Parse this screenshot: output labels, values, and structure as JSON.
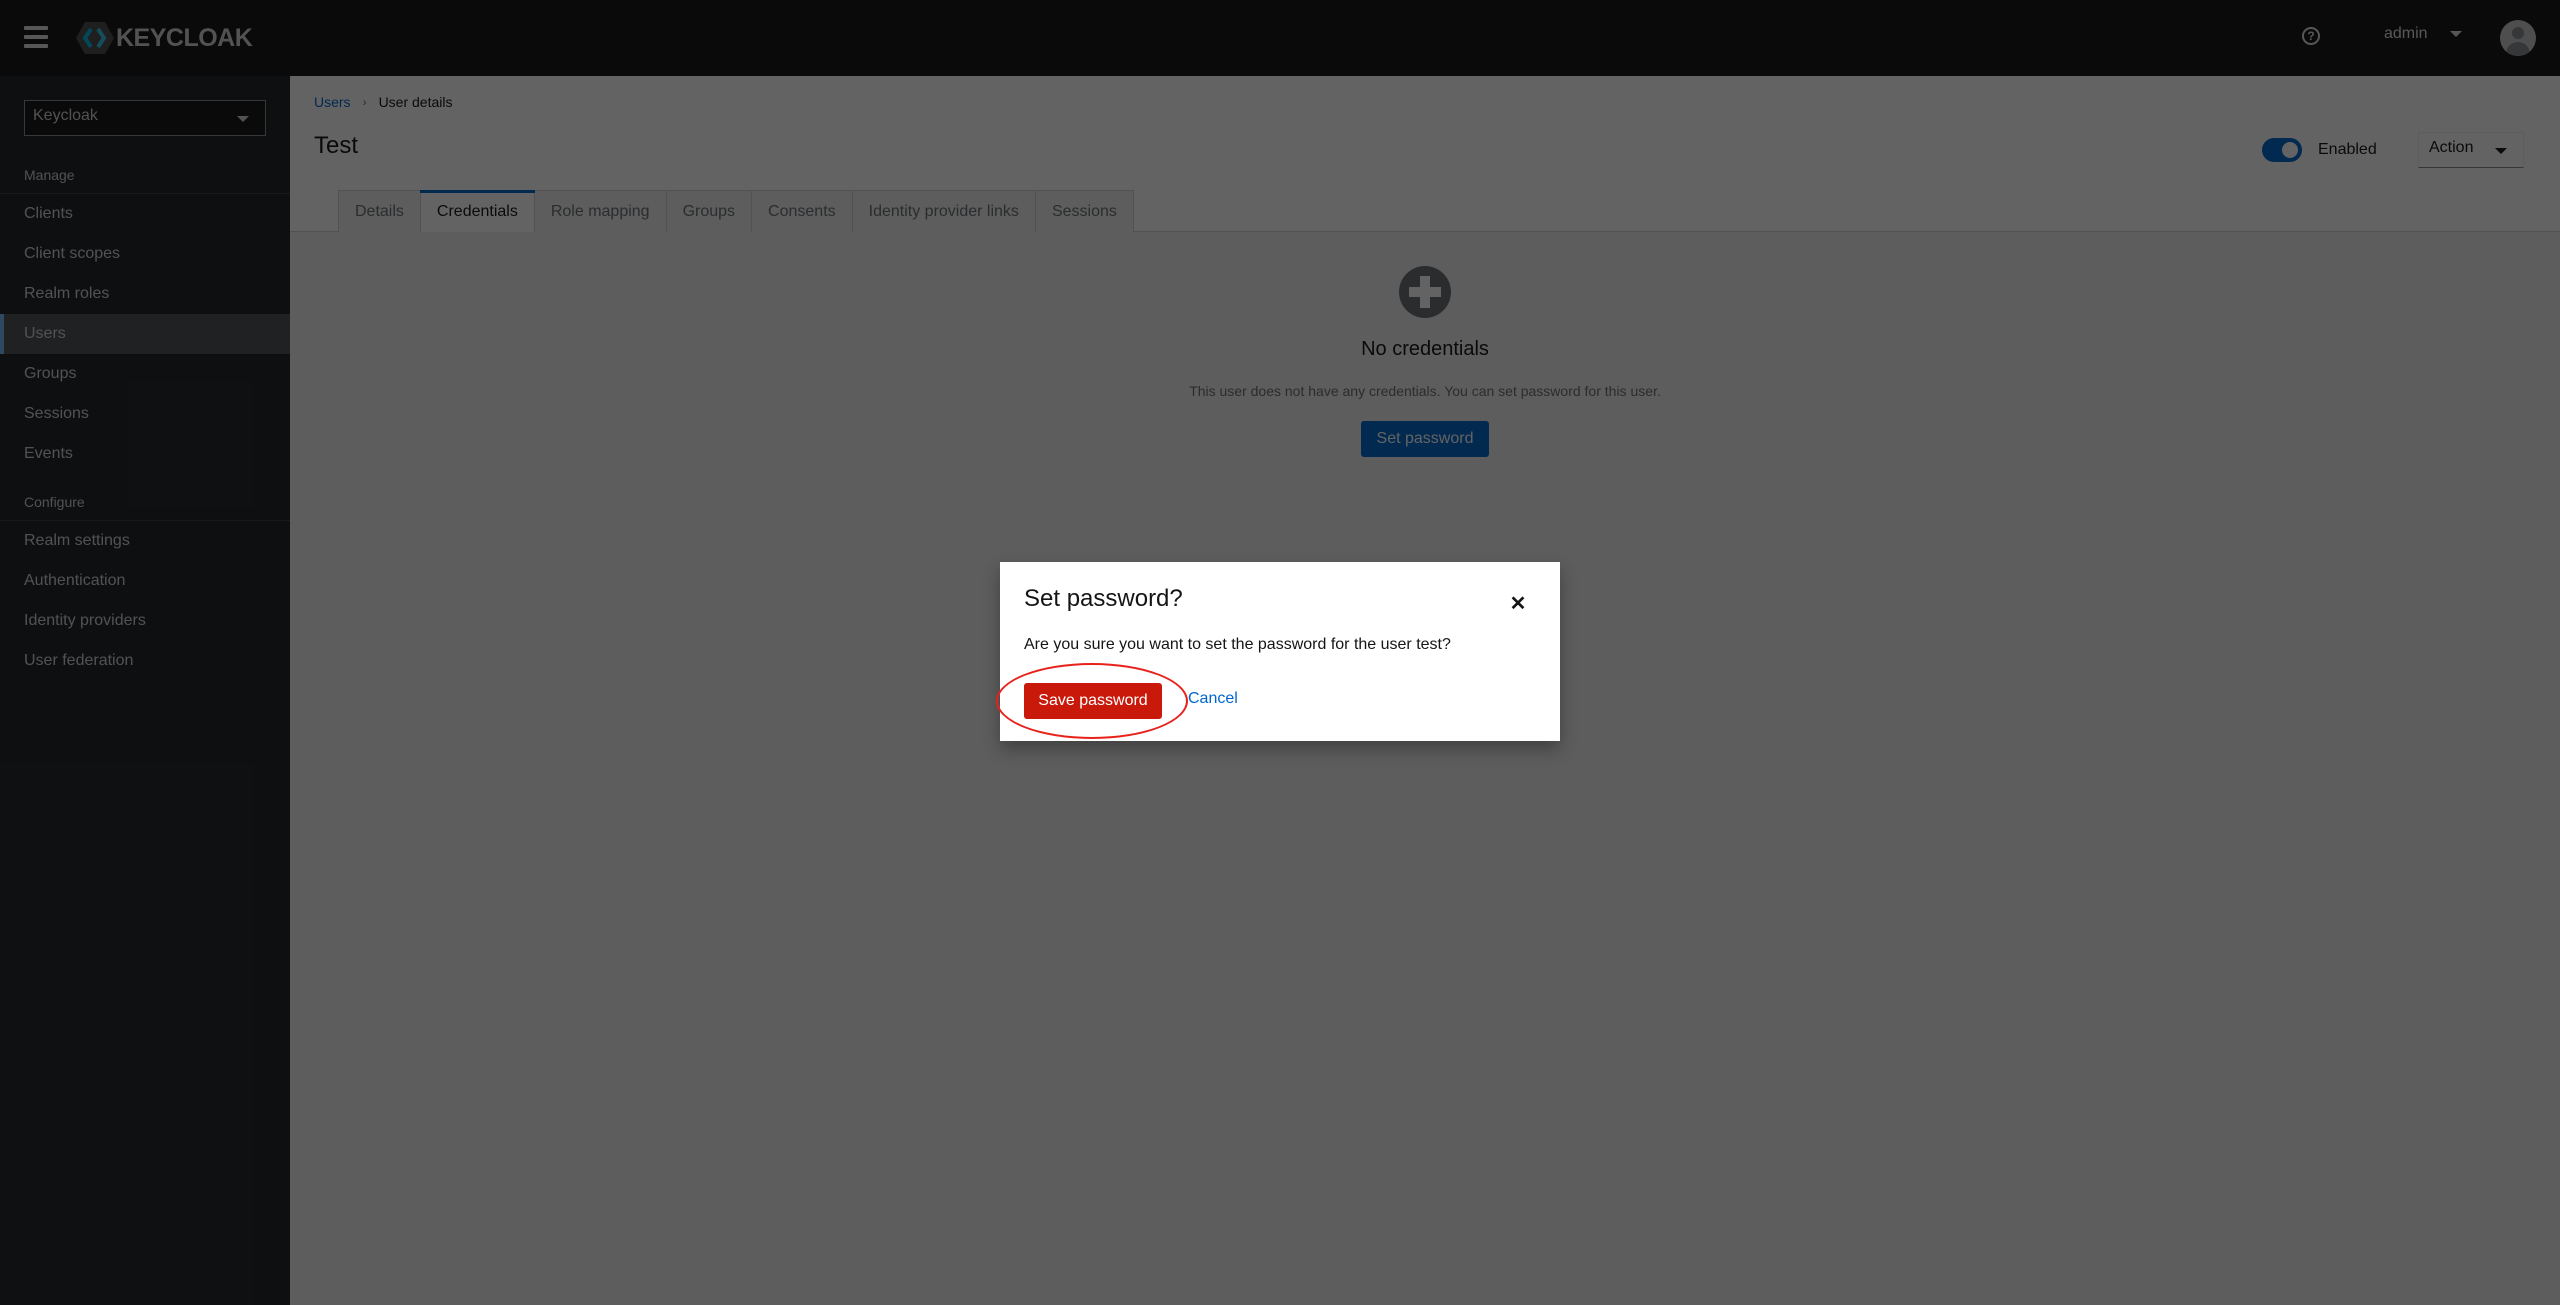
{
  "header": {
    "brand": "KEYCLOAK",
    "help_icon": "help-circle-icon",
    "username": "admin"
  },
  "sidebar": {
    "realm": "Keycloak",
    "sections": [
      {
        "title": "Manage",
        "items": [
          {
            "label": "Clients",
            "active": false
          },
          {
            "label": "Client scopes",
            "active": false
          },
          {
            "label": "Realm roles",
            "active": false
          },
          {
            "label": "Users",
            "active": true
          },
          {
            "label": "Groups",
            "active": false
          },
          {
            "label": "Sessions",
            "active": false
          },
          {
            "label": "Events",
            "active": false
          }
        ]
      },
      {
        "title": "Configure",
        "items": [
          {
            "label": "Realm settings",
            "active": false
          },
          {
            "label": "Authentication",
            "active": false
          },
          {
            "label": "Identity providers",
            "active": false
          },
          {
            "label": "User federation",
            "active": false
          }
        ]
      }
    ]
  },
  "page": {
    "breadcrumb": [
      "Users",
      "User details"
    ],
    "title": "Test",
    "enabled_label": "Enabled",
    "enabled": true,
    "action_label": "Action",
    "tabs": [
      {
        "label": "Details",
        "active": false
      },
      {
        "label": "Credentials",
        "active": true
      },
      {
        "label": "Role mapping",
        "active": false
      },
      {
        "label": "Groups",
        "active": false
      },
      {
        "label": "Consents",
        "active": false
      },
      {
        "label": "Identity provider links",
        "active": false
      },
      {
        "label": "Sessions",
        "active": false
      }
    ],
    "empty_state": {
      "icon": "plus-circle-icon",
      "title": "No credentials",
      "body": "This user does not have any credentials. You can set password for this user.",
      "button": "Set password"
    }
  },
  "modal": {
    "title": "Set password?",
    "body": "Are you sure you want to set the password for the user test?",
    "confirm": "Save password",
    "cancel": "Cancel",
    "confirm_color": "#c9190b"
  },
  "colors": {
    "primary": "#0066cc",
    "danger": "#c9190b",
    "annotation": "#e8221b"
  }
}
